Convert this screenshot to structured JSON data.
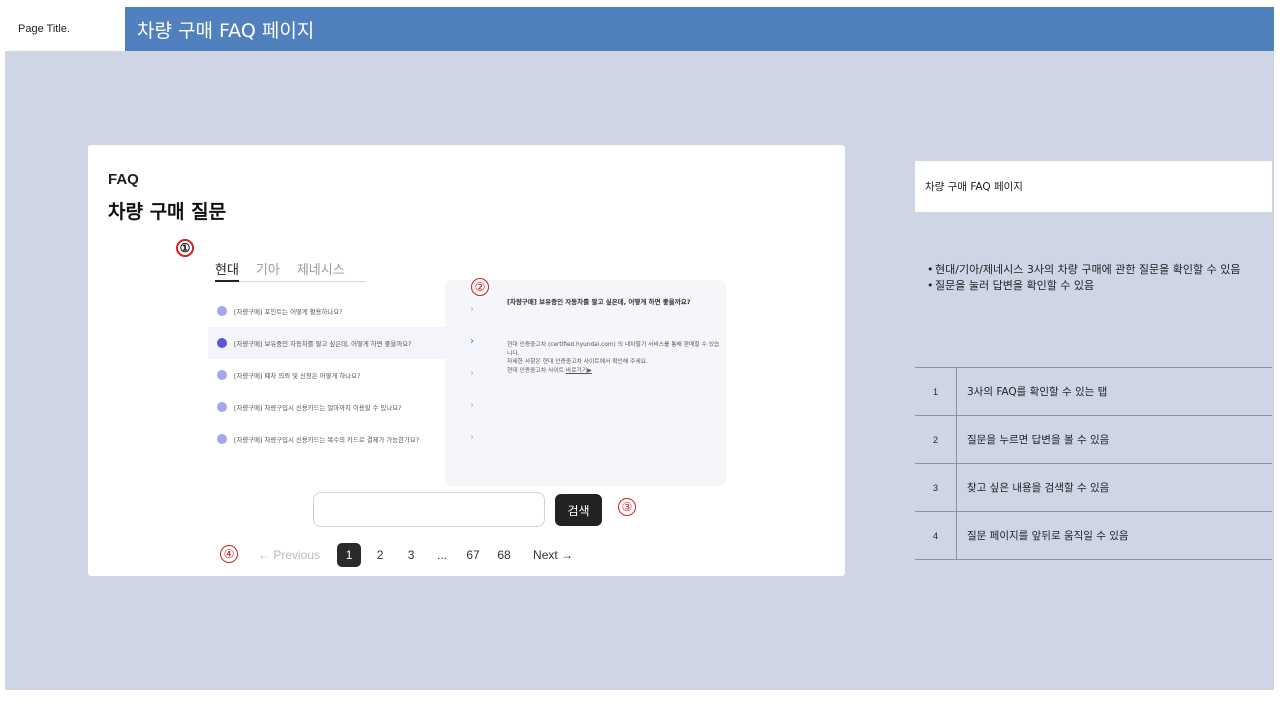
{
  "header": {
    "label": "Page Title.",
    "title": "차량 구매 FAQ 페이지"
  },
  "mockup": {
    "faq_label": "FAQ",
    "heading": "차량 구매 질문",
    "tabs": [
      "현대",
      "기아",
      "제네시스"
    ],
    "active_tab": "현대",
    "questions": [
      "[차량구매] 포인트는 어떻게 활용하나요?",
      "[차량구매] 보유중인 자동차를 팔고 싶은데, 어떻게 하면 좋을까요?",
      "[차량구매] 폐차 의뢰 및 신청은 어떻게 하나요?",
      "[차량구매] 차량구입시 신용카드는 얼마까지 이용할 수 있나요?",
      "[차량구매] 차량구입시 신용카드는 복수의 카드로 결제가 가능한가요?"
    ],
    "selected_question_index": 1,
    "chevron": "›",
    "answer": {
      "title": "[차량구매] 보유중인 자동차를 팔고 싶은데, 어떻게 하면 좋을까요?",
      "line1": "현대 인증중고차 (certified.hyundai.com) 의 내차팔기 서비스를 통해 판매할 수 있습니다.",
      "line2": "자세한 사항은 현대 인증중고차 사이트에서 확인해 주세요.",
      "line3_prefix": "현대 인증중고차 사이트 ",
      "link": "바로가기▶"
    },
    "search": {
      "placeholder": "",
      "button": "검색"
    },
    "pagination": {
      "prev": "← Previous",
      "pages": [
        "1",
        "2",
        "3",
        "...",
        "67",
        "68"
      ],
      "active_page": "1",
      "next": "Next →"
    },
    "markers": [
      "①",
      "②",
      "③",
      "④"
    ]
  },
  "sidebar": {
    "heading": "차량 구매 FAQ 페이지",
    "bullets": [
      "현대/기아/제네시스 3사의 차량 구매에 관한 질문을 확인할 수 있음",
      "질문을 눌러 답변을 확인할 수 있음"
    ],
    "bullet_mark": "•",
    "legend": [
      {
        "num": "1",
        "text": "3사의 FAQ를 확인할 수 있는 탭"
      },
      {
        "num": "2",
        "text": "질문을 누르면 답변을 볼 수 있음"
      },
      {
        "num": "3",
        "text": "찾고 싶은 내용을 검색할 수 있음"
      },
      {
        "num": "4",
        "text": "질문 페이지를 앞뒤로 움직일 수 있음"
      }
    ]
  },
  "colors": {
    "title_bar": "#5080bd",
    "board": "#ced6e6",
    "marker": "#d02020",
    "dot": "#a3a6e8",
    "dot_selected": "#5a58d8"
  }
}
